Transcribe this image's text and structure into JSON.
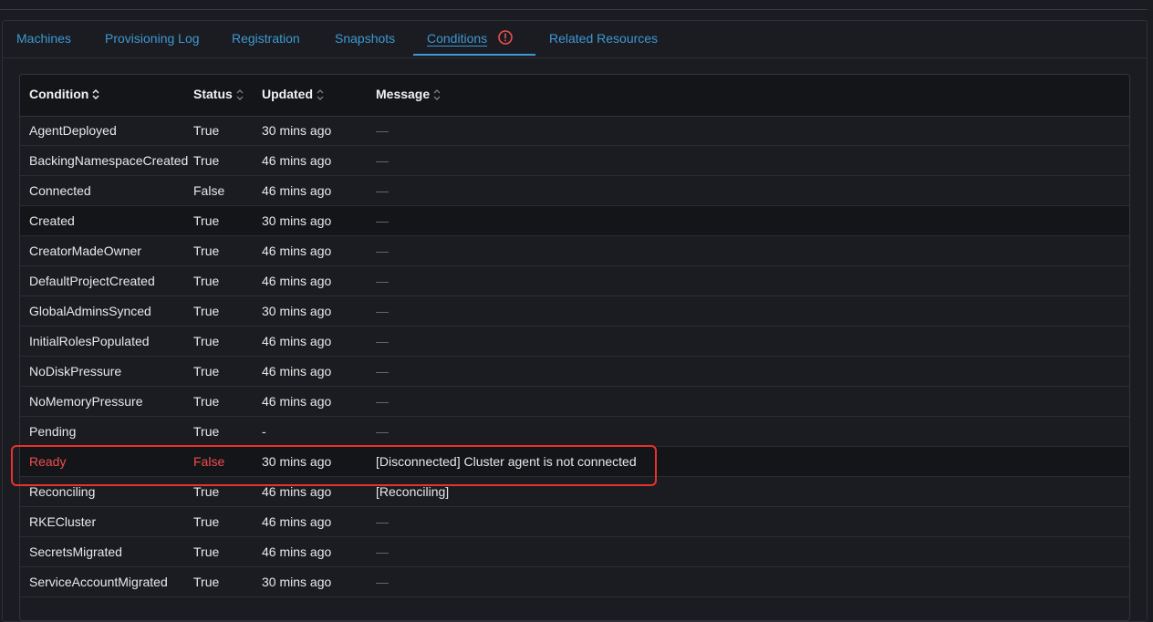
{
  "tabs": [
    {
      "label": "Machines"
    },
    {
      "label": "Provisioning Log"
    },
    {
      "label": "Registration"
    },
    {
      "label": "Snapshots"
    },
    {
      "label": "Conditions",
      "active": true
    },
    {
      "label": "Related Resources"
    }
  ],
  "colors": {
    "accent": "#3d98d3",
    "error": "#f04e4e",
    "highlight": "#e8322a"
  },
  "table": {
    "headers": [
      "Condition",
      "Status",
      "Updated",
      "Message"
    ],
    "rows": [
      {
        "condition": "AgentDeployed",
        "status": "True",
        "updated": "30 mins ago",
        "message": "—"
      },
      {
        "condition": "BackingNamespaceCreated",
        "status": "True",
        "updated": "46 mins ago",
        "message": "—"
      },
      {
        "condition": "Connected",
        "status": "False",
        "updated": "46 mins ago",
        "message": "—"
      },
      {
        "condition": "Created",
        "status": "True",
        "updated": "30 mins ago",
        "message": "—"
      },
      {
        "condition": "CreatorMadeOwner",
        "status": "True",
        "updated": "46 mins ago",
        "message": "—"
      },
      {
        "condition": "DefaultProjectCreated",
        "status": "True",
        "updated": "46 mins ago",
        "message": "—"
      },
      {
        "condition": "GlobalAdminsSynced",
        "status": "True",
        "updated": "30 mins ago",
        "message": "—"
      },
      {
        "condition": "InitialRolesPopulated",
        "status": "True",
        "updated": "46 mins ago",
        "message": "—"
      },
      {
        "condition": "NoDiskPressure",
        "status": "True",
        "updated": "46 mins ago",
        "message": "—"
      },
      {
        "condition": "NoMemoryPressure",
        "status": "True",
        "updated": "46 mins ago",
        "message": "—"
      },
      {
        "condition": "Pending",
        "status": "True",
        "updated": "-",
        "message": "—"
      },
      {
        "condition": "Ready",
        "status": "False",
        "updated": "30 mins ago",
        "message": "[Disconnected] Cluster agent is not connected",
        "error": true
      },
      {
        "condition": "Reconciling",
        "status": "True",
        "updated": "46 mins ago",
        "message": "[Reconciling]"
      },
      {
        "condition": "RKECluster",
        "status": "True",
        "updated": "46 mins ago",
        "message": "—"
      },
      {
        "condition": "SecretsMigrated",
        "status": "True",
        "updated": "46 mins ago",
        "message": "—"
      },
      {
        "condition": "ServiceAccountMigrated",
        "status": "True",
        "updated": "30 mins ago",
        "message": "—"
      }
    ]
  }
}
